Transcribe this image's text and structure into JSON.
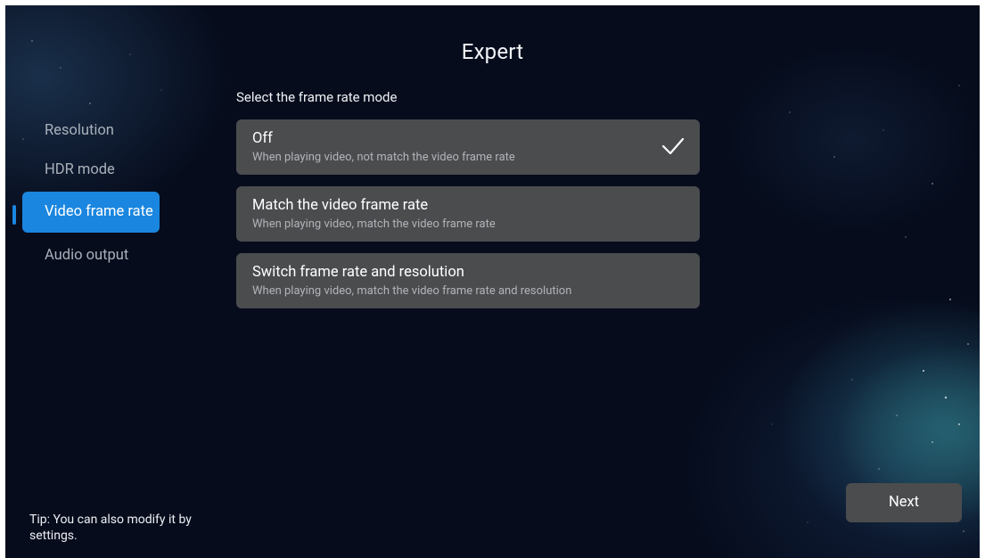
{
  "header": {
    "title": "Expert"
  },
  "content": {
    "subtitle": "Select the frame rate mode"
  },
  "sidebar": {
    "items": [
      {
        "label": "Resolution"
      },
      {
        "label": "HDR mode"
      },
      {
        "label": "Video frame rate"
      },
      {
        "label": "Audio output"
      }
    ],
    "active_label": "Video frame rate"
  },
  "options": [
    {
      "title": "Off",
      "description": "When playing video, not match the video frame rate",
      "selected": true
    },
    {
      "title": "Match the video frame rate",
      "description": "When playing video, match the video frame rate",
      "selected": false
    },
    {
      "title": "Switch frame rate and resolution",
      "description": "When playing video, match the video frame rate and resolution",
      "selected": false
    }
  ],
  "footer": {
    "tip": "Tip: You can also modify it by settings.",
    "next_label": "Next"
  },
  "icons": {
    "selected_option": "check-icon"
  },
  "colors": {
    "background": "#060c1c",
    "accent": "#1a86df",
    "card": "#4b4c4e",
    "text_primary": "#ffffff",
    "text_secondary": "#b0b3b8",
    "sidebar_inactive": "#a9b0ba"
  }
}
